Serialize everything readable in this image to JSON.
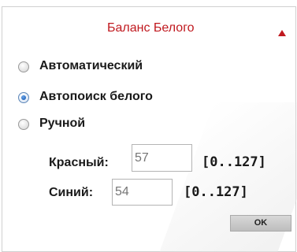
{
  "panel": {
    "title": "Баланс Белого",
    "collapse_icon": "triangle-up-icon"
  },
  "mode": {
    "selected": "Автопоиск белого",
    "options": [
      {
        "label": "Автоматический",
        "checked": false
      },
      {
        "label": "Автопоиск белого",
        "checked": true
      },
      {
        "label": "Ручной",
        "checked": false
      }
    ]
  },
  "manual": {
    "red": {
      "label": "Красный:",
      "placeholder": "57",
      "range": "[0..127]"
    },
    "blue": {
      "label": "Синий:",
      "placeholder": "54",
      "range": "[0..127]"
    }
  },
  "actions": {
    "ok_label": "OK"
  },
  "colors": {
    "title": "#c0191f",
    "accent_radio": "#1d5fb8"
  }
}
